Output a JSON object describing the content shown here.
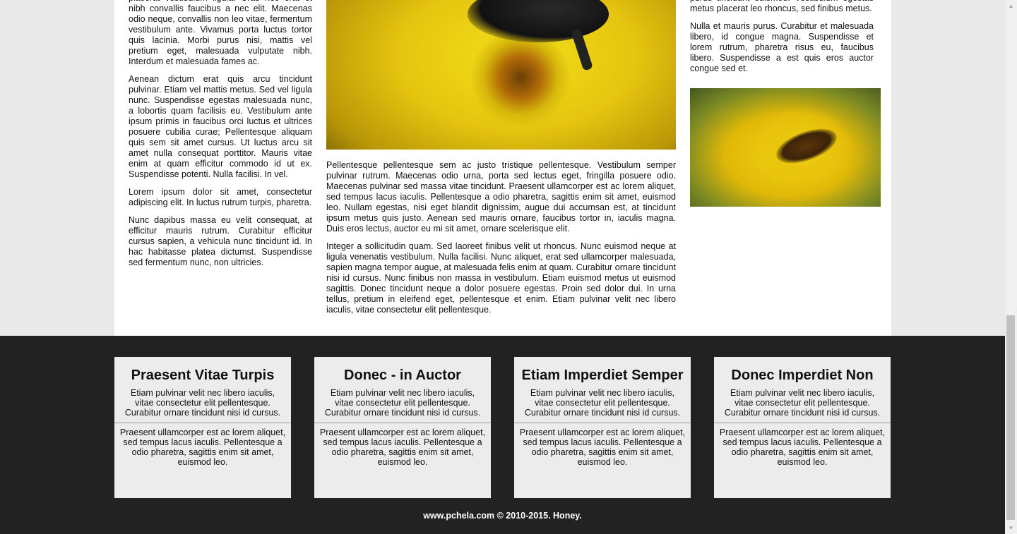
{
  "left_column": {
    "paragraphs": [
      "placerat vestibulum ligula. Cras nec erat et nibh convallis faucibus a nec elit. Maecenas odio neque, convallis non leo vitae, fermentum vestibulum ante. Vivamus porta luctus tortor quis lacinia. Morbi purus nisi, mattis vel pretium eget, malesuada vulputate nibh. Interdum et malesuada fames ac.",
      "Aenean dictum erat quis arcu tincidunt pulvinar. Etiam vel mattis metus. Sed vel ligula nunc. Suspendisse egestas malesuada nunc, a lobortis quam facilisis eu. Vestibulum ante ipsum primis in faucibus orci luctus et ultrices posuere cubilia curae; Pellentesque aliquam quis sem sit amet cursus. Ut luctus arcu sit amet nulla consequat porttitor. Mauris vitae enim at quam efficitur commodo id ut ex. Suspendisse potenti. Nulla facilisi. In vel.",
      "Lorem ipsum dolor sit amet, consectetur adipiscing elit. In luctus rutrum turpis, pharetra.",
      "Nunc dapibus massa eu velit consequat, at efficitur mauris rutrum. Curabitur efficitur cursus sapien, a vehicula nunc tincidunt id. In hac habitasse platea dictumst. Suspendisse sed fermentum nunc, non ultricies."
    ]
  },
  "middle_column": {
    "paragraphs": [
      "Pellentesque pellentesque sem ac justo tristique pellentesque. Vestibulum semper pulvinar rutrum. Maecenas odio urna, porta sed lectus eget, fringilla posuere odio. Maecenas pulvinar sed massa vitae tincidunt. Praesent ullamcorper est ac lorem aliquet, sed tempus lacus iaculis. Pellentesque a odio pharetra, sagittis enim sit amet, euismod leo. Nullam egestas, nisi eget blandit dignissim, augue dui accumsan est, at tincidunt ipsum metus quis justo. Aenean sed mauris ornare, faucibus tortor in, iaculis magna. Duis eros lectus, auctor eu mi sit amet, ornare scelerisque elit.",
      "Integer a sollicitudin quam. Sed laoreet finibus velit ut rhoncus. Nunc euismod neque at ligula venenatis vestibulum. Nulla facilisi. Nunc aliquet, erat sed ullamcorper malesuada, sapien magna tempor augue, at malesuada felis enim at quam. Curabitur ornare tincidunt nisi id cursus. Nunc finibus non massa in vestibulum. Etiam euismod metus ut euismod sagittis. Donec tincidunt neque a dolor posuere egestas. Proin sed dolor dui. In urna tellus, pretium in eleifend eget, pellentesque et enim. Etiam pulvinar velit nec libero iaculis, vitae consectetur elit pellentesque."
    ]
  },
  "right_column": {
    "paragraphs": [
      "purus tincidunt euismod. Vestibulum egestas metus placerat leo rhoncus, sed finibus metus.",
      "Nulla et mauris purus. Curabitur et malesuada libero, id congue magna. Suspendisse et lorem rutrum, pharetra risus eu, faucibus libero. Suspendisse a est quis eros auctor congue sed et."
    ]
  },
  "footer_cards": [
    {
      "title": "Praesent Vitae Turpis",
      "intro": "Etiam pulvinar velit nec libero iaculis, vitae consectetur elit pellentesque. Curabitur ornare tincidunt nisi id cursus.",
      "body": "Praesent ullamcorper est ac lorem aliquet, sed tempus lacus iaculis. Pellentesque a odio pharetra, sagittis enim sit amet, euismod leo."
    },
    {
      "title": "Donec - in Auctor",
      "intro": "Etiam pulvinar velit nec libero iaculis, vitae consectetur elit pellentesque. Curabitur ornare tincidunt nisi id cursus.",
      "body": "Praesent ullamcorper est ac lorem aliquet, sed tempus lacus iaculis. Pellentesque a odio pharetra, sagittis enim sit amet, euismod leo."
    },
    {
      "title": "Etiam Imperdiet Semper",
      "intro": "Etiam pulvinar velit nec libero iaculis, vitae consectetur elit pellentesque. Curabitur ornare tincidunt nisi id cursus.",
      "body": "Praesent ullamcorper est ac lorem aliquet, sed tempus lacus iaculis. Pellentesque a odio pharetra, sagittis enim sit amet, euismod leo."
    },
    {
      "title": "Donec Imperdiet Non",
      "intro": "Etiam pulvinar velit nec libero iaculis, vitae consectetur elit pellentesque. Curabitur ornare tincidunt nisi id cursus.",
      "body": "Praesent ullamcorper est ac lorem aliquet, sed tempus lacus iaculis. Pellentesque a odio pharetra, sagittis enim sit amet, euismod leo."
    }
  ],
  "copyright": "www.pchela.com © 2010-2015. Honey.",
  "colors": {
    "footer_bg": "#222222",
    "card_bg": "#ececec",
    "page_bg": "#ffffff"
  }
}
